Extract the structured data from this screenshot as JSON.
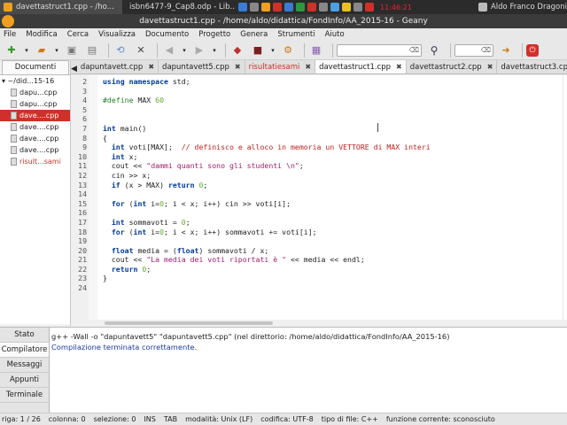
{
  "taskbar": {
    "items": [
      {
        "label": "davettastruct1.cpp - /ho...",
        "color": "#f0a020",
        "active": true
      },
      {
        "label": "isbn6477-9_Cap8.odp - Lib...",
        "color": "#4a8ad8",
        "active": false
      }
    ],
    "tray_colors": [
      "#3a7bd5",
      "#888888",
      "#f0a020",
      "#d0302a",
      "#3a7bd5",
      "#2a9a40",
      "#d0302a",
      "#888888",
      "#4aa0e0",
      "#e8c020",
      "#888888",
      "#d0302a"
    ],
    "clock": "11:46:21",
    "user": "Aldo Franco Dragoni"
  },
  "window": {
    "title": "davettastruct1.cpp - /home/aldo/didattica/FondInfo/AA_2015-16 - Geany"
  },
  "menu": [
    "File",
    "Modifica",
    "Cerca",
    "Visualizza",
    "Documento",
    "Progetto",
    "Genera",
    "Strumenti",
    "Aiuto"
  ],
  "sidebar": {
    "tab": "Documenti",
    "root": "~/did...15-16",
    "files": [
      {
        "label": "dapu...cpp",
        "selected": false,
        "red": false
      },
      {
        "label": "dapu...cpp",
        "selected": false,
        "red": false
      },
      {
        "label": "dave....cpp",
        "selected": true,
        "red": false
      },
      {
        "label": "dave....cpp",
        "selected": false,
        "red": false
      },
      {
        "label": "dave....cpp",
        "selected": false,
        "red": false
      },
      {
        "label": "dave....cpp",
        "selected": false,
        "red": false
      },
      {
        "label": "risult...sami",
        "selected": false,
        "red": true
      }
    ]
  },
  "tabs": [
    {
      "label": "dapuntavett.cpp",
      "active": false,
      "red": false
    },
    {
      "label": "dapuntavett5.cpp",
      "active": false,
      "red": false
    },
    {
      "label": "risultatiesami",
      "active": false,
      "red": true
    },
    {
      "label": "davettastruct1.cpp",
      "active": true,
      "red": false
    },
    {
      "label": "davettastruct2.cpp",
      "active": false,
      "red": false
    },
    {
      "label": "davettastruct3.cpp",
      "active": false,
      "red": false
    }
  ],
  "editor": {
    "lines": [
      {
        "n": "2",
        "html": "<span class='kw'>using namespace</span> std;"
      },
      {
        "n": "3",
        "html": ""
      },
      {
        "n": "4",
        "html": "<span class='pp'>#define</span> MAX <span class='num'>60</span>"
      },
      {
        "n": "5",
        "html": ""
      },
      {
        "n": "6",
        "html": ""
      },
      {
        "n": "7",
        "html": "<span class='kw'>int</span> main()"
      },
      {
        "n": "8",
        "html": "{"
      },
      {
        "n": "9",
        "html": "  <span class='kw'>int</span> voti[MAX];  <span class='cmt'>// definisco e alloco in memoria un VETTORE di MAX interi</span>"
      },
      {
        "n": "10",
        "html": "  <span class='kw'>int</span> x;"
      },
      {
        "n": "11",
        "html": "  cout << <span class='str'>\"dammi quanti sono gli studenti \\n\"</span>;"
      },
      {
        "n": "12",
        "html": "  cin >> x;"
      },
      {
        "n": "13",
        "html": "  <span class='kw'>if</span> (x > MAX) <span class='kw'>return</span> <span class='num'>0</span>;"
      },
      {
        "n": "14",
        "html": ""
      },
      {
        "n": "15",
        "html": "  <span class='kw'>for</span> (<span class='kw'>int</span> i=<span class='num'>0</span>; i < x; i++) cin >> voti[i];"
      },
      {
        "n": "16",
        "html": ""
      },
      {
        "n": "17",
        "html": "  <span class='kw'>int</span> sommavoti = <span class='num'>0</span>;"
      },
      {
        "n": "18",
        "html": "  <span class='kw'>for</span> (<span class='kw'>int</span> i=<span class='num'>0</span>; i < x; i++) sommavoti += voti[i];"
      },
      {
        "n": "19",
        "html": ""
      },
      {
        "n": "20",
        "html": "  <span class='kw'>float</span> media = (<span class='kw'>float</span>) sommavoti / x;"
      },
      {
        "n": "21",
        "html": "  cout << <span class='str'>\"La media dei voti riportati è \"</span> << media << endl;"
      },
      {
        "n": "22",
        "html": "  <span class='kw'>return</span> <span class='num'>0</span>;"
      },
      {
        "n": "23",
        "html": "}"
      },
      {
        "n": "24",
        "html": ""
      }
    ]
  },
  "messages": {
    "tabs": [
      "Stato",
      "Compilatore",
      "Messaggi",
      "Appunti",
      "Terminale"
    ],
    "active_tab": "Compilatore",
    "lines": [
      {
        "text": "g++ -Wall -o \"dapuntavett5\" \"dapuntavett5.cpp\" (nel direttorio: /home/aldo/didattica/FondInfo/AA_2015-16)",
        "blue": false
      },
      {
        "text": "Compilazione terminata correttamente.",
        "blue": true
      }
    ]
  },
  "statusbar": {
    "riga": "riga: 1 / 26",
    "colonna": "colonna: 0",
    "selezione": "selezione: 0",
    "ins": "INS",
    "tab": "TAB",
    "modalita": "modalità: Unix (LF)",
    "codifica": "codifica: UTF-8",
    "tipo": "tipo di file: C++",
    "funzione": "funzione corrente: sconosciuto"
  }
}
